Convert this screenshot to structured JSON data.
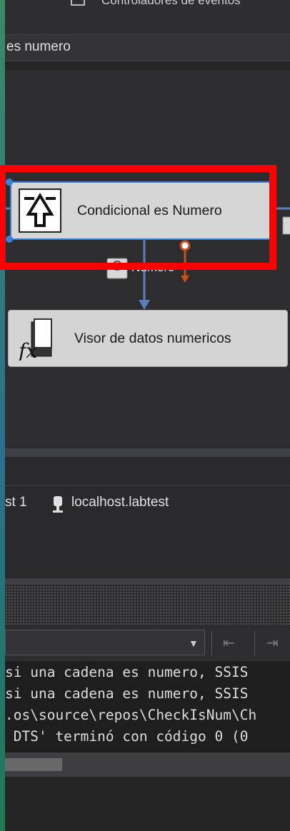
{
  "top_bar": {
    "text": "Controladores de eventos"
  },
  "package_title": "es numero",
  "nodes": {
    "conditional": {
      "label": "Condicional es Numero"
    },
    "visor": {
      "label": "Visor de datos numericos"
    }
  },
  "path": {
    "label": "Numero"
  },
  "connections": {
    "prefix": "st 1",
    "server": "localhost.labtest"
  },
  "output": {
    "lines": [
      "si una cadena es numero, SSIS",
      "si una cadena es numero, SSIS",
      ".os\\source\\repos\\CheckIsNum\\Ch",
      " DTS' terminó con código 0 (0"
    ]
  },
  "colors": {
    "highlight": "#ff0000",
    "selection": "#3e7fd6",
    "path_arrow": "#5a7fb8",
    "error_path": "#c8501e"
  }
}
